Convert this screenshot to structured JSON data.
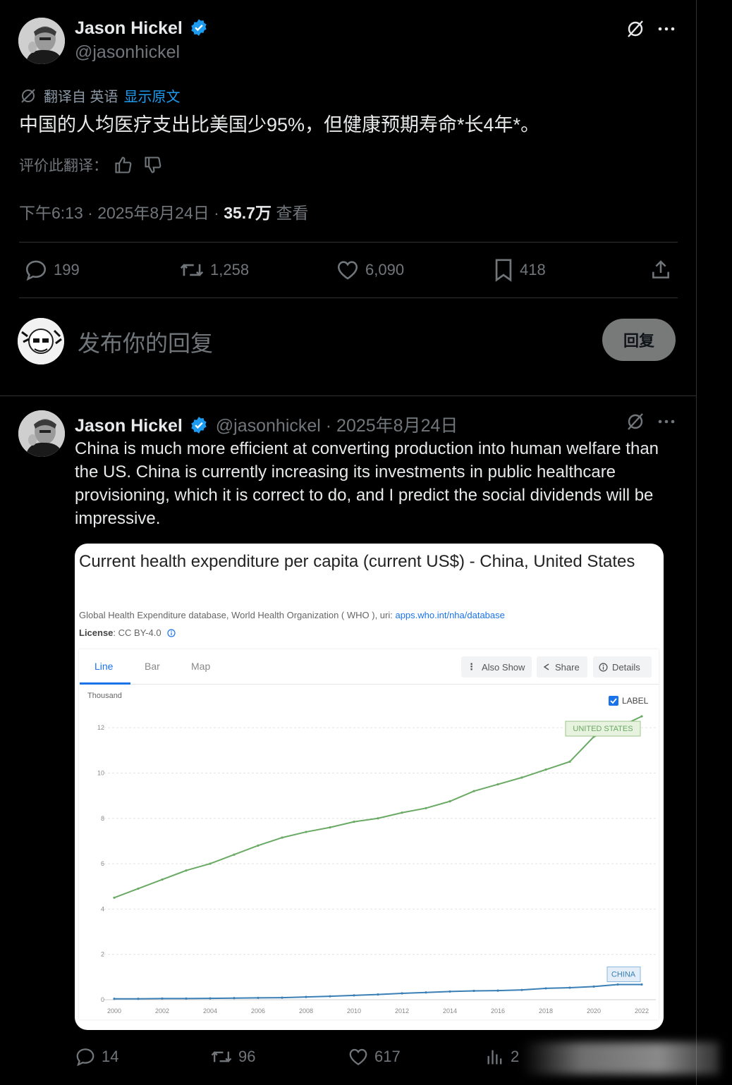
{
  "main_tweet": {
    "author": {
      "name": "Jason Hickel",
      "handle": "@jasonhickel"
    },
    "translation": {
      "label": "翻译自 英语",
      "show_original": "显示原文"
    },
    "text": "中国的人均医疗支出比美国少95%，但健康预期寿命*长4年*。",
    "rate_translation": "评价此翻译：",
    "meta": {
      "time_date": "下午6:13 · 2025年8月24日 · ",
      "views_value": "35.7万",
      "views_label": " 查看"
    },
    "stats": {
      "replies": "199",
      "reposts": "1,258",
      "likes": "6,090",
      "bookmarks": "418"
    }
  },
  "reply_box": {
    "placeholder": "发布你的回复",
    "button": "回复"
  },
  "quoted_tweet": {
    "author": {
      "name": "Jason Hickel",
      "handle": "@jasonhickel",
      "date": " · 2025年8月24日"
    },
    "text": "China is much more efficient at converting production into human welfare than the US.  China is currently increasing its investments in public healthcare provisioning, which it is correct to do, and I predict the social dividends will be impressive.",
    "stats": {
      "replies": "14",
      "reposts": "96",
      "likes": "617",
      "views": "2"
    }
  },
  "chart_card": {
    "title": "Current health expenditure per capita (current US$) - China, United States",
    "source_text": "Global Health Expenditure database, World Health Organization ( WHO ), uri: ",
    "source_link": "apps.who.int/nha/database",
    "license_label": "License",
    "license_value": " : CC BY-4.0",
    "tabs": [
      "Line",
      "Bar",
      "Map"
    ],
    "active_tab": "Line",
    "tools": [
      "Also Show",
      "Share",
      "Details"
    ],
    "label_checkbox": "LABEL",
    "unit": "Thousand"
  },
  "colors": {
    "accent": "#1d9bf0",
    "us_line": "#6aaa64",
    "china_line": "#3a7fb5"
  },
  "chart_data": {
    "type": "line",
    "x": [
      2000,
      2001,
      2002,
      2003,
      2004,
      2005,
      2006,
      2007,
      2008,
      2009,
      2010,
      2011,
      2012,
      2013,
      2014,
      2015,
      2016,
      2017,
      2018,
      2019,
      2020,
      2021,
      2022
    ],
    "series": [
      {
        "name": "UNITED STATES",
        "values": [
          4.5,
          4.9,
          5.3,
          5.7,
          6.0,
          6.4,
          6.8,
          7.15,
          7.4,
          7.6,
          7.85,
          8.0,
          8.25,
          8.45,
          8.75,
          9.2,
          9.5,
          9.8,
          10.15,
          10.5,
          11.6,
          12.0,
          12.5
        ]
      },
      {
        "name": "CHINA",
        "values": [
          0.04,
          0.04,
          0.05,
          0.05,
          0.06,
          0.07,
          0.08,
          0.09,
          0.12,
          0.15,
          0.19,
          0.23,
          0.28,
          0.32,
          0.36,
          0.39,
          0.4,
          0.43,
          0.5,
          0.53,
          0.58,
          0.67,
          0.67
        ]
      }
    ],
    "xticks": [
      "2000",
      "2002",
      "2004",
      "2006",
      "2008",
      "2010",
      "2012",
      "2014",
      "2016",
      "2018",
      "2020",
      "2022"
    ],
    "yticks": [
      "0",
      "2",
      "4",
      "6",
      "8",
      "10",
      "12"
    ],
    "ylim": [
      0,
      13.0
    ],
    "ylabel": "Thousand",
    "grid": true
  }
}
